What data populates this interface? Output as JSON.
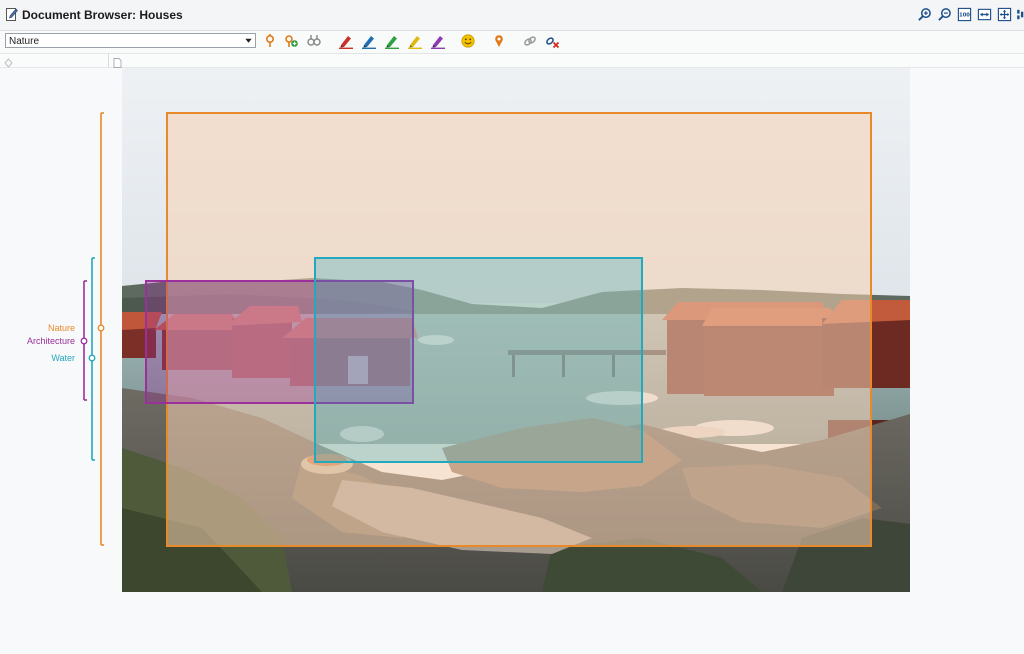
{
  "window": {
    "title": "Document Browser: Houses"
  },
  "toolbar": {
    "code_select_value": "Nature"
  },
  "codes": [
    {
      "name": "Nature",
      "color": "#e88a2a"
    },
    {
      "name": "Architecture",
      "color": "#9b2f9b"
    },
    {
      "name": "Water",
      "color": "#23a9bd"
    }
  ],
  "icons": {
    "title_tools": [
      "zoom-in-icon",
      "zoom-out-icon",
      "actual-size-icon",
      "fit-width-icon",
      "fit-page-icon",
      "more-icon"
    ],
    "toolbar": [
      "code-pin-icon",
      "add-code-icon",
      "memo-icon",
      "highlighter-red-icon",
      "highlighter-blue-icon",
      "highlighter-green-icon",
      "highlighter-yellow-icon",
      "highlighter-purple-icon",
      "emoji-icon",
      "location-pin-icon",
      "link-icon",
      "remove-link-icon"
    ]
  }
}
